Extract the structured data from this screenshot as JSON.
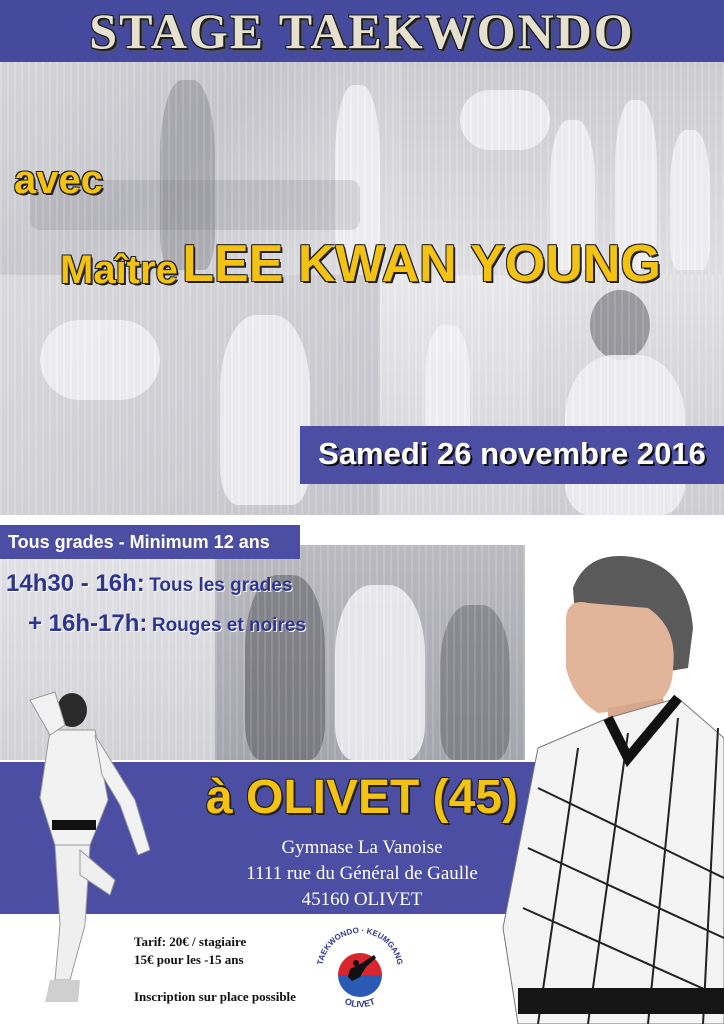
{
  "colors": {
    "band": "#4b4ea3",
    "accent_yellow": "#f3c212",
    "navy": "#2d3590",
    "title": "#e6e1cf"
  },
  "header": {
    "title": "STAGE TAEKWONDO"
  },
  "intro": {
    "with": "avec",
    "master_prefix": "Maître",
    "master_name": "LEE KWAN YOUNG"
  },
  "date": {
    "label": "Samedi 26 novembre 2016"
  },
  "grades": {
    "label": "Tous grades - Minimum 12 ans"
  },
  "schedule": [
    {
      "time": "14h30 - 16h:",
      "group": "Tous les grades"
    },
    {
      "time": "+ 16h-17h:",
      "group": "Rouges et noires"
    }
  ],
  "location": {
    "city": "à OLIVET (45)",
    "venue": "Gymnase La Vanoise",
    "street": "1111 rue du Général de Gaulle",
    "postal": "45160 OLIVET"
  },
  "pricing": {
    "line1": "Tarif: 20€ / stagiaire",
    "line2": "15€ pour les -15 ans",
    "note": "Inscription sur place possible"
  },
  "logo": {
    "top_text": "TAEKWONDO · KEUMGANG",
    "bottom_text": "OLIVET",
    "icon": "kicking-figure-logo"
  }
}
